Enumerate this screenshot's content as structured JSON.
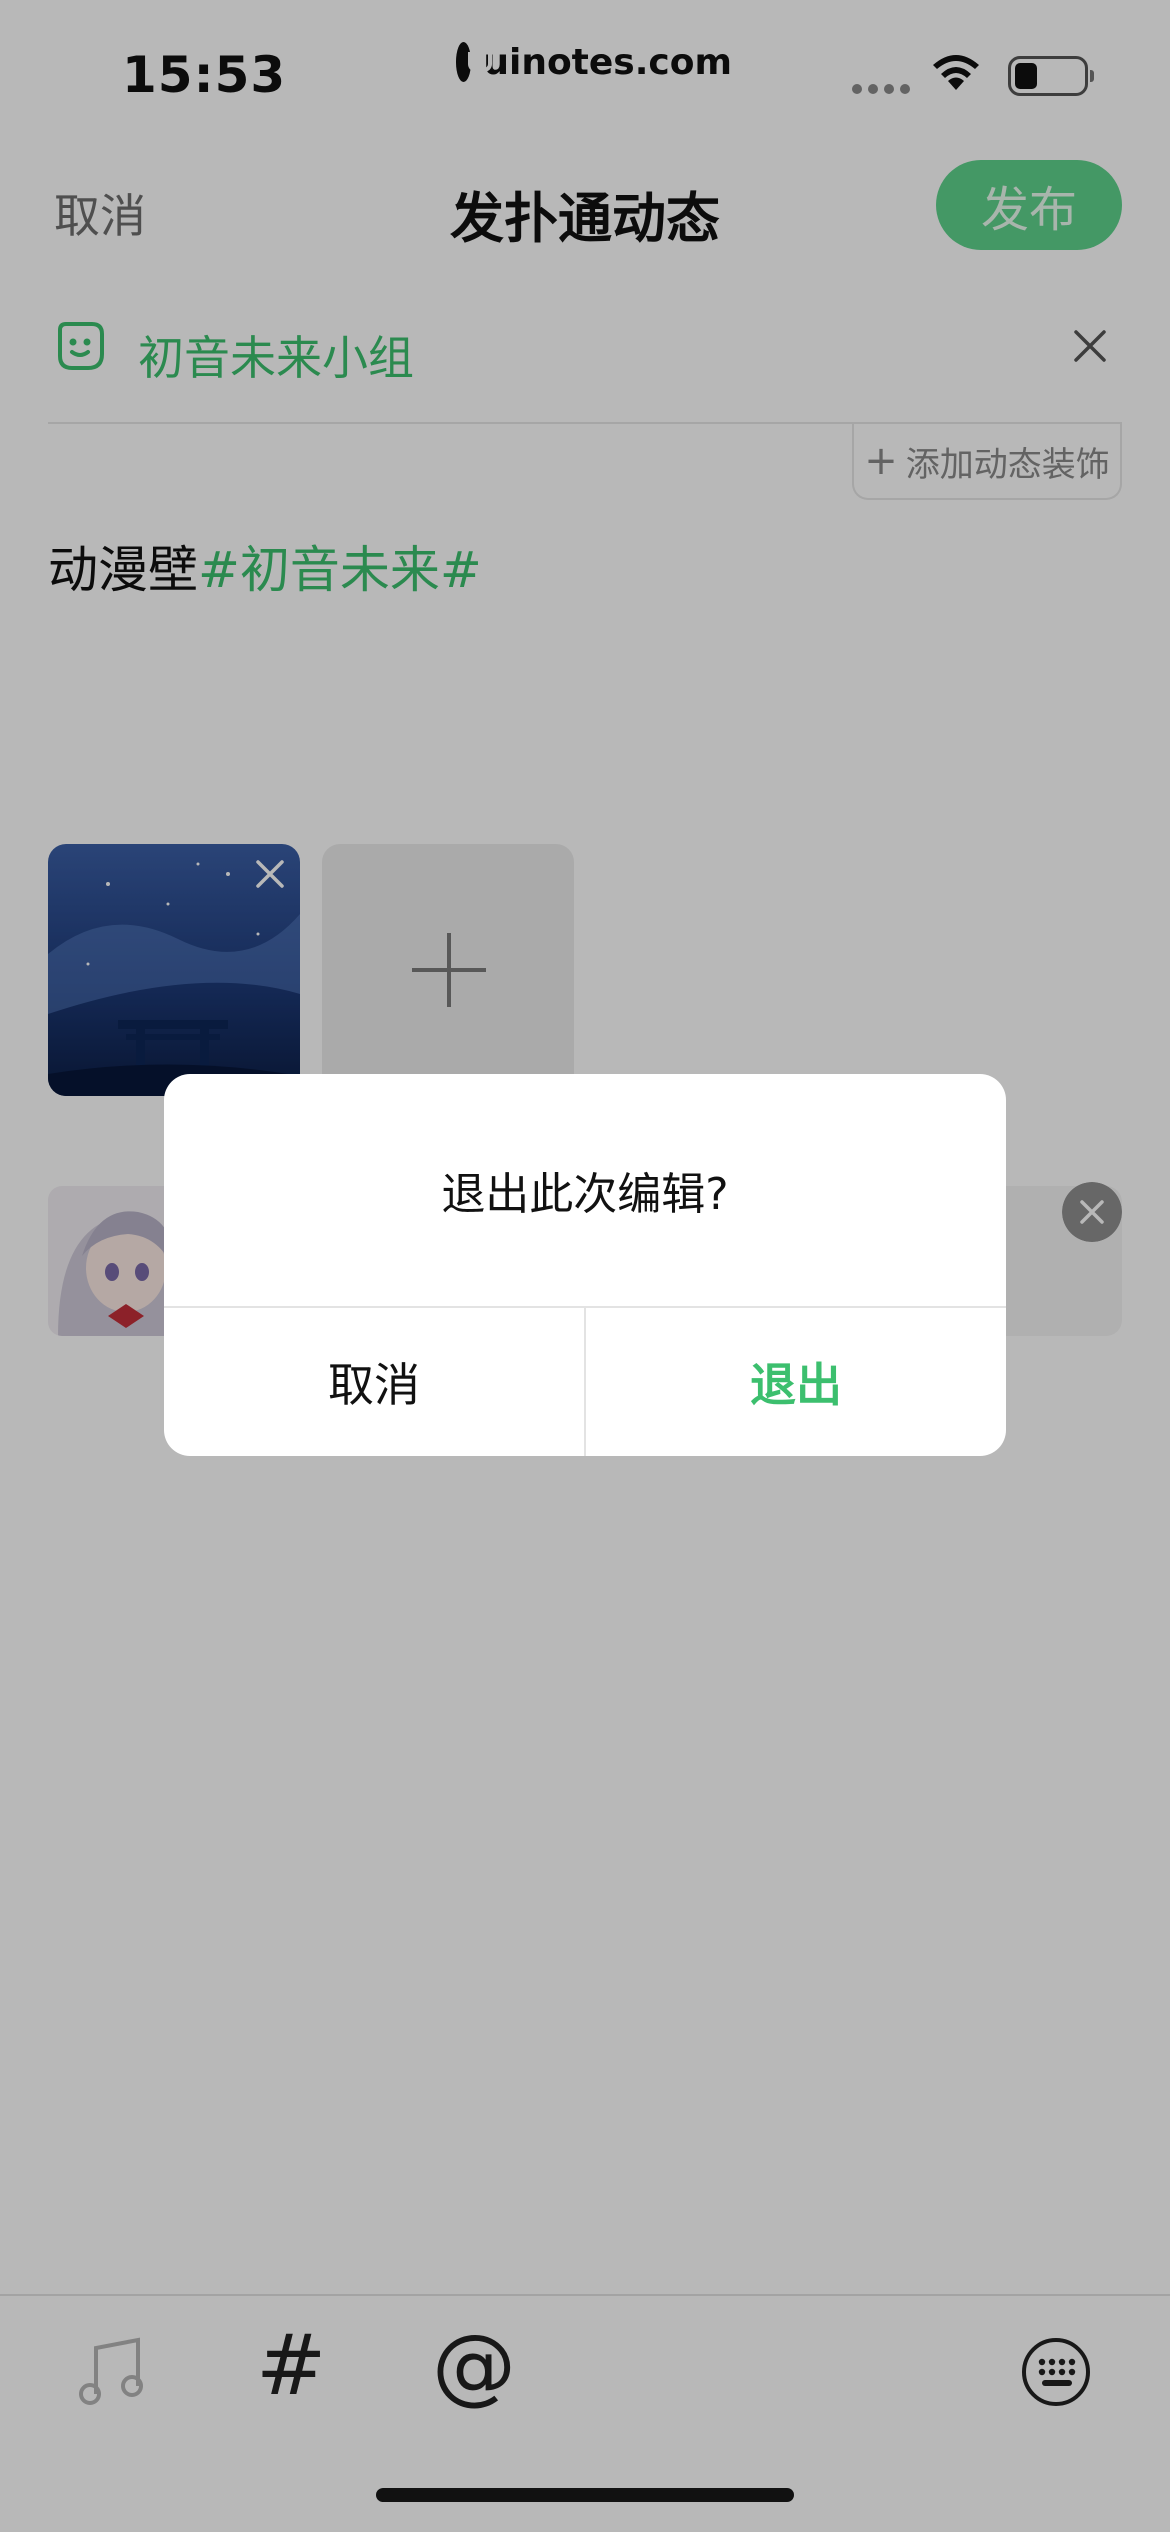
{
  "status_bar": {
    "time": "15:53",
    "url": "uinotes.com"
  },
  "nav": {
    "cancel_label": "取消",
    "title": "发扑通动态",
    "publish_label": "发布"
  },
  "group": {
    "name": "初音未来小组"
  },
  "decor_button": {
    "label": "添加动态装饰"
  },
  "post": {
    "text": "动漫壁",
    "hashtag": "#初音未来#"
  },
  "dialog": {
    "message": "退出此次编辑?",
    "cancel_label": "取消",
    "exit_label": "退出"
  },
  "toolbar": {
    "hash_symbol": "#",
    "at_symbol": "@"
  },
  "colors": {
    "accent_green": "#3cbf6e",
    "publish_button": "#5fd38d",
    "overlay": "#000000"
  }
}
